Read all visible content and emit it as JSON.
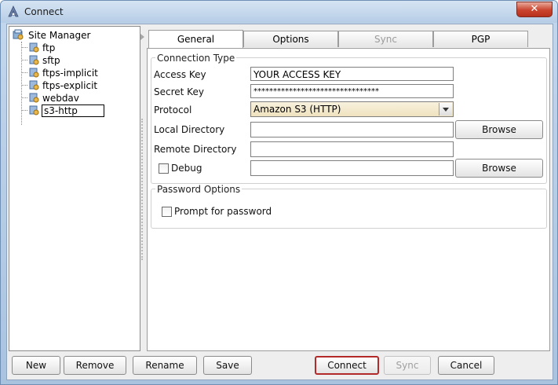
{
  "window": {
    "title": "Connect",
    "close_glyph": "✕"
  },
  "tree": {
    "root": "Site Manager",
    "items": [
      {
        "label": "ftp"
      },
      {
        "label": "sftp"
      },
      {
        "label": "ftps-implicit"
      },
      {
        "label": "ftps-explicit"
      },
      {
        "label": "webdav"
      },
      {
        "label": "s3-http"
      }
    ]
  },
  "tabs": [
    {
      "label": "General",
      "state": "active"
    },
    {
      "label": "Options",
      "state": "normal"
    },
    {
      "label": "Sync",
      "state": "disabled"
    },
    {
      "label": "PGP",
      "state": "normal"
    }
  ],
  "connection": {
    "group_title": "Connection Type",
    "access_key_label": "Access Key",
    "access_key_value": "YOUR ACCESS KEY",
    "secret_key_label": "Secret Key",
    "secret_key_value": "********************************",
    "protocol_label": "Protocol",
    "protocol_value": "Amazon S3 (HTTP)",
    "local_dir_label": "Local Directory",
    "local_dir_value": "",
    "remote_dir_label": "Remote Directory",
    "remote_dir_value": "",
    "debug_label": "Debug",
    "debug_value": "",
    "browse_label": "Browse"
  },
  "password": {
    "group_title": "Password Options",
    "prompt_label": "Prompt for password"
  },
  "buttons": {
    "new": "New",
    "remove": "Remove",
    "rename": "Rename",
    "save": "Save",
    "connect": "Connect",
    "sync": "Sync",
    "cancel": "Cancel"
  },
  "colors": {
    "accent_border": "#b32a2a",
    "protocol_bg": "#f3e8c9"
  }
}
